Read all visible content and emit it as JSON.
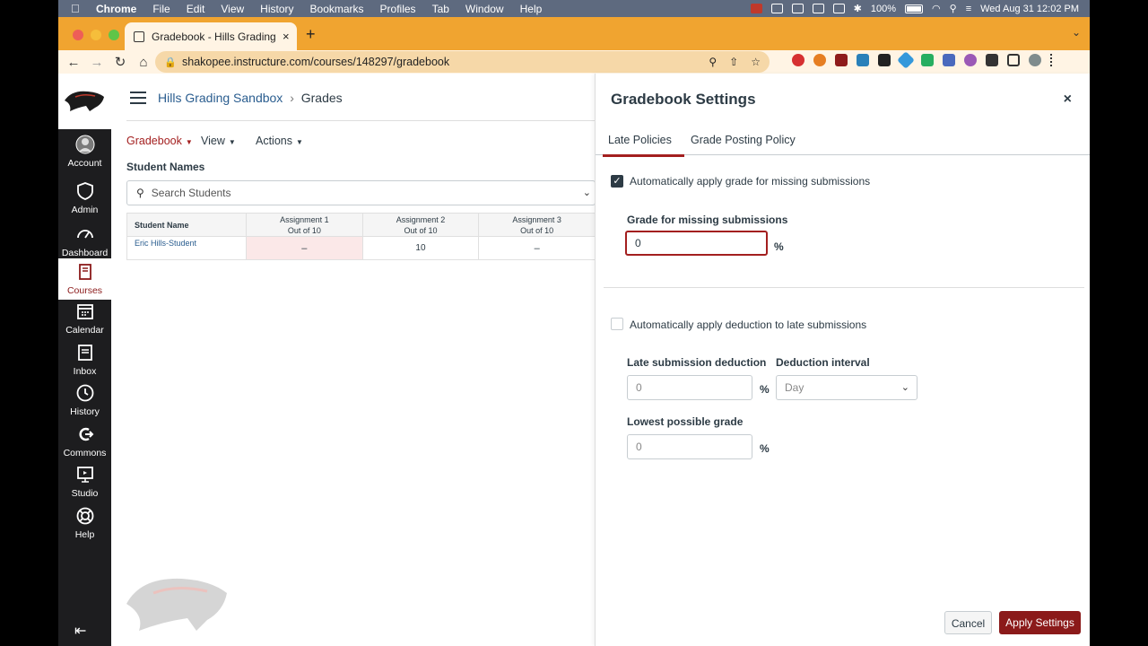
{
  "menubar": {
    "app": "Chrome",
    "items": [
      "File",
      "Edit",
      "View",
      "History",
      "Bookmarks",
      "Profiles",
      "Tab",
      "Window",
      "Help"
    ],
    "battery": "100%",
    "datetime": "Wed Aug 31  12:02 PM"
  },
  "browser": {
    "tab_title": "Gradebook - Hills Grading Sand",
    "url": "shakopee.instructure.com/courses/148297/gradebook"
  },
  "sidebar": {
    "items": [
      {
        "label": "Account"
      },
      {
        "label": "Admin"
      },
      {
        "label": "Dashboard"
      },
      {
        "label": "Courses"
      },
      {
        "label": "Calendar"
      },
      {
        "label": "Inbox"
      },
      {
        "label": "History"
      },
      {
        "label": "Commons"
      },
      {
        "label": "Studio"
      },
      {
        "label": "Help"
      }
    ]
  },
  "breadcrumb": {
    "course": "Hills Grading Sandbox",
    "separator": "›",
    "page": "Grades"
  },
  "gradebook": {
    "menus": [
      "Gradebook",
      "View",
      "Actions"
    ],
    "student_names_label": "Student Names",
    "search_placeholder": "Search Students",
    "columns": [
      {
        "title": "Student Name"
      },
      {
        "title": "Assignment 1",
        "sub": "Out of 10"
      },
      {
        "title": "Assignment 2",
        "sub": "Out of 10"
      },
      {
        "title": "Assignment 3",
        "sub": "Out of 10"
      }
    ],
    "rows": [
      {
        "name": "Eric Hills-Student",
        "a1": "–",
        "a2": "10",
        "a3": "–"
      }
    ]
  },
  "settings": {
    "title": "Gradebook Settings",
    "close": "×",
    "tabs": [
      "Late Policies",
      "Grade Posting Policy"
    ],
    "missing_checkbox_label": "Automatically apply grade for missing submissions",
    "missing_checked": true,
    "missing_grade_label": "Grade for missing submissions",
    "missing_grade_value": "0",
    "late_checkbox_label": "Automatically apply deduction to late submissions",
    "late_checked": false,
    "late_deduction_label": "Late submission deduction",
    "late_deduction_value": "0",
    "interval_label": "Deduction interval",
    "interval_value": "Day",
    "lowest_label": "Lowest possible grade",
    "lowest_value": "0",
    "percent": "%",
    "cancel": "Cancel",
    "apply": "Apply Settings"
  }
}
